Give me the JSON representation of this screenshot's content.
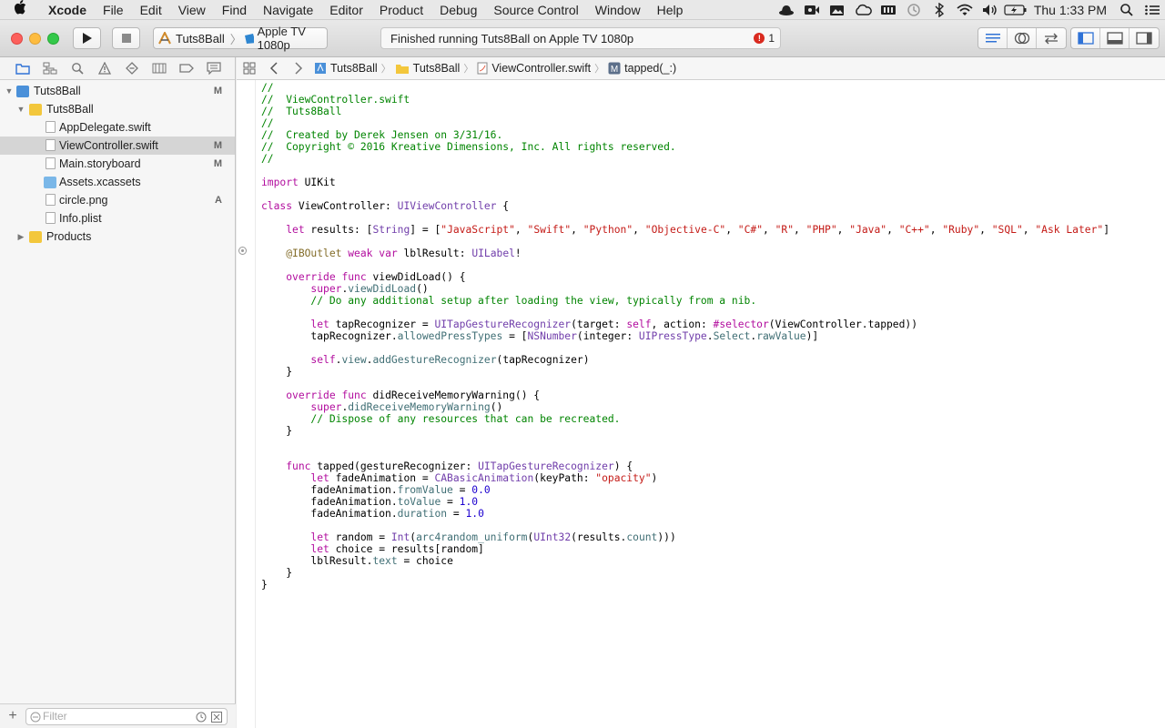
{
  "menubar": {
    "app_name": "Xcode",
    "items": [
      "File",
      "Edit",
      "View",
      "Find",
      "Navigate",
      "Editor",
      "Product",
      "Debug",
      "Source Control",
      "Window",
      "Help"
    ],
    "clock": "Thu 1:33 PM"
  },
  "toolbar": {
    "scheme": "Tuts8Ball",
    "destination": "Apple TV 1080p",
    "activity": "Finished running Tuts8Ball on Apple TV 1080p",
    "error_count": "1"
  },
  "navigator": {
    "items": [
      {
        "label": "Tuts8Ball",
        "badge": "M"
      },
      {
        "label": "Tuts8Ball",
        "badge": ""
      },
      {
        "label": "AppDelegate.swift",
        "badge": ""
      },
      {
        "label": "ViewController.swift",
        "badge": "M"
      },
      {
        "label": "Main.storyboard",
        "badge": "M"
      },
      {
        "label": "Assets.xcassets",
        "badge": ""
      },
      {
        "label": "circle.png",
        "badge": "A"
      },
      {
        "label": "Info.plist",
        "badge": ""
      },
      {
        "label": "Products",
        "badge": ""
      }
    ],
    "filter_placeholder": "Filter"
  },
  "jumpbar": {
    "crumbs": [
      "Tuts8Ball",
      "Tuts8Ball",
      "ViewController.swift",
      "tapped(_:)"
    ]
  },
  "editor": {
    "lines": [
      "//",
      "//  ViewController.swift",
      "//  Tuts8Ball",
      "//",
      "//  Created by Derek Jensen on 3/31/16.",
      "//  Copyright © 2016 Kreative Dimensions, Inc. All rights reserved.",
      "//",
      "",
      "import UIKit",
      "",
      "class ViewController: UIViewController {",
      "",
      "    let results: [String] = [\"JavaScript\", \"Swift\", \"Python\", \"Objective-C\", \"C#\", \"R\", \"PHP\", \"Java\", \"C++\", \"Ruby\", \"SQL\", \"Ask Later\"]",
      "",
      "    @IBOutlet weak var lblResult: UILabel!",
      "",
      "    override func viewDidLoad() {",
      "        super.viewDidLoad()",
      "        // Do any additional setup after loading the view, typically from a nib.",
      "",
      "        let tapRecognizer = UITapGestureRecognizer(target: self, action: #selector(ViewController.tapped))",
      "        tapRecognizer.allowedPressTypes = [NSNumber(integer: UIPressType.Select.rawValue)]",
      "",
      "        self.view.addGestureRecognizer(tapRecognizer)",
      "    }",
      "",
      "    override func didReceiveMemoryWarning() {",
      "        super.didReceiveMemoryWarning()",
      "        // Dispose of any resources that can be recreated.",
      "    }",
      "",
      "",
      "    func tapped(gestureRecognizer: UITapGestureRecognizer) {",
      "        let fadeAnimation = CABasicAnimation(keyPath: \"opacity\")",
      "        fadeAnimation.fromValue = 0.0",
      "        fadeAnimation.toValue = 1.0",
      "        fadeAnimation.duration = 1.0",
      "",
      "        let random = Int(arc4random_uniform(UInt32(results.count)))",
      "        let choice = results[random]",
      "        lblResult.text = choice",
      "    }",
      "}"
    ]
  },
  "colors": {
    "comment": "#008400",
    "keyword": "#b20d9e",
    "string": "#c41a16",
    "number": "#1c00cf",
    "type": "#703daa",
    "selection": "#d5d5d5"
  }
}
